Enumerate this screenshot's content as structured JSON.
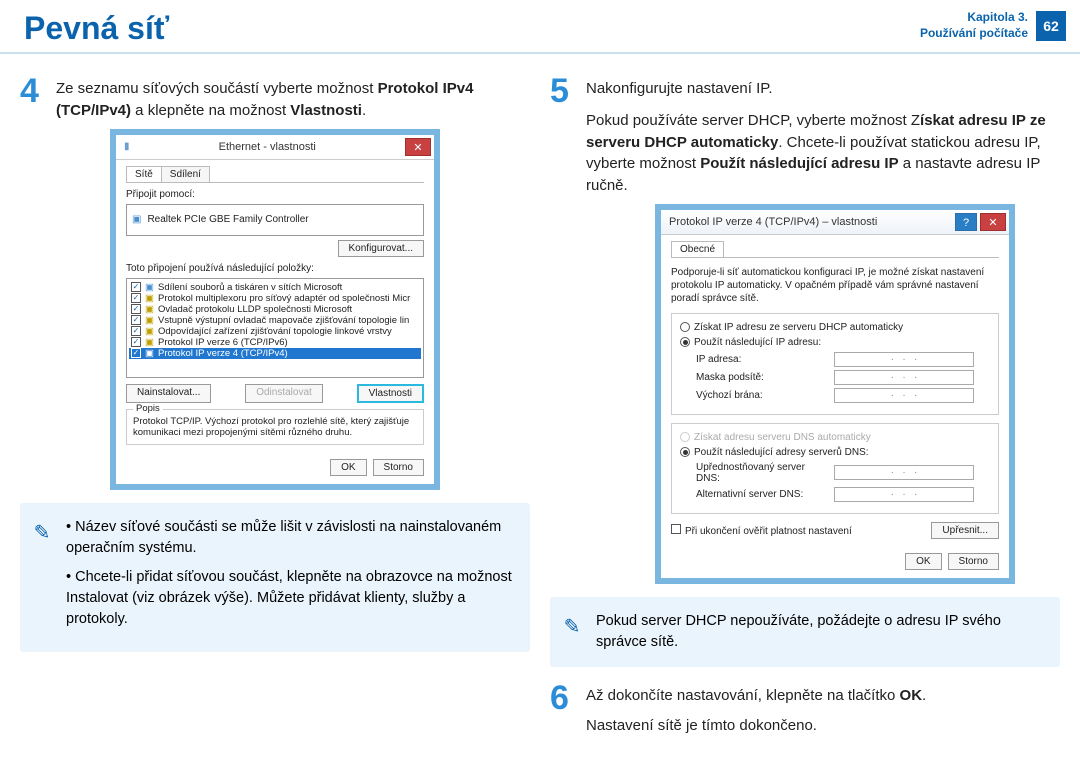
{
  "header": {
    "title": "Pevná síť",
    "chapterLine1": "Kapitola 3.",
    "chapterLine2": "Používání počítače",
    "pageNumber": "62"
  },
  "step4": {
    "num": "4",
    "text_a": "Ze seznamu síťových součástí vyberte možnost ",
    "text_b": "Protokol IPv4 (TCP/IPv4)",
    "text_c": " a klepněte na možnost ",
    "text_d": "Vlastnosti",
    "text_e": "."
  },
  "step5": {
    "num": "5",
    "line1": "Nakonfigurujte nastavení IP.",
    "line2a": "Pokud používáte server DHCP, vyberte možnost Z",
    "line2b": "ískat adresu IP ze serveru DHCP automaticky",
    "line2c": ". Chcete-li používat statickou adresu IP, vyberte možnost ",
    "line2d": "Použít následující adresu IP",
    "line2e": " a nastavte adresu IP ručně."
  },
  "step6": {
    "num": "6",
    "line1a": "Až dokončíte nastavování, klepněte na tlačítko ",
    "line1b": "OK",
    "line1c": ".",
    "line2": "Nastavení sítě je tímto dokončeno."
  },
  "noteLeft": {
    "bullet1": "Název síťové součásti se může lišit v závislosti na nainstalovaném operačním systému.",
    "bullet2": "Chcete-li přidat síťovou součást, klepněte na obrazovce na možnost Instalovat (viz obrázek výše). Můžete přidávat klienty, služby a protokoly."
  },
  "noteRight": {
    "text": "Pokud server DHCP nepoužíváte, požádejte o adresu IP svého správce sítě."
  },
  "dlg1": {
    "title": "Ethernet - vlastnosti",
    "tab1": "Sítě",
    "tab2": "Sdílení",
    "connect_using": "Připojit pomocí:",
    "adapter": "Realtek PCIe GBE Family Controller",
    "configure": "Konfigurovat...",
    "uses_items": "Toto připojení používá následující položky:",
    "items": [
      "Sdílení souborů a tiskáren v sítích Microsoft",
      "Protokol multiplexoru pro síťový adaptér od společnosti Micr",
      "Ovladač protokolu LLDP společnosti Microsoft",
      "Vstupně výstupní ovladač mapovače zjišťování topologie lin",
      "Odpovídající zařízení zjišťování topologie linkové vrstvy",
      "Protokol IP verze 6 (TCP/IPv6)",
      "Protokol IP verze 4 (TCP/IPv4)"
    ],
    "install": "Nainstalovat...",
    "uninstall": "Odinstalovat",
    "properties": "Vlastnosti",
    "desc_legend": "Popis",
    "desc_text": "Protokol TCP/IP. Výchozí protokol pro rozlehlé sítě, který zajišťuje komunikaci mezi propojenými sítěmi různého druhu.",
    "ok": "OK",
    "cancel": "Storno"
  },
  "dlg2": {
    "title": "Protokol IP verze 4 (TCP/IPv4) – vlastnosti",
    "tab": "Obecné",
    "intro": "Podporuje-li síť automatickou konfiguraci IP, je možné získat nastavení protokolu IP automaticky. V opačném případě vám správné nastavení poradí správce sítě.",
    "radio_auto": "Získat IP adresu ze serveru DHCP automaticky",
    "radio_manual": "Použít následující IP adresu:",
    "ip": "IP adresa:",
    "mask": "Maska podsítě:",
    "gateway": "Výchozí brána:",
    "dns_auto": "Získat adresu serveru DNS automaticky",
    "dns_manual": "Použít následující adresy serverů DNS:",
    "dns1": "Upřednostňovaný server DNS:",
    "dns2": "Alternativní server DNS:",
    "validate": "Při ukončení ověřit platnost nastavení",
    "advanced": "Upřesnit...",
    "ok": "OK",
    "cancel": "Storno"
  }
}
